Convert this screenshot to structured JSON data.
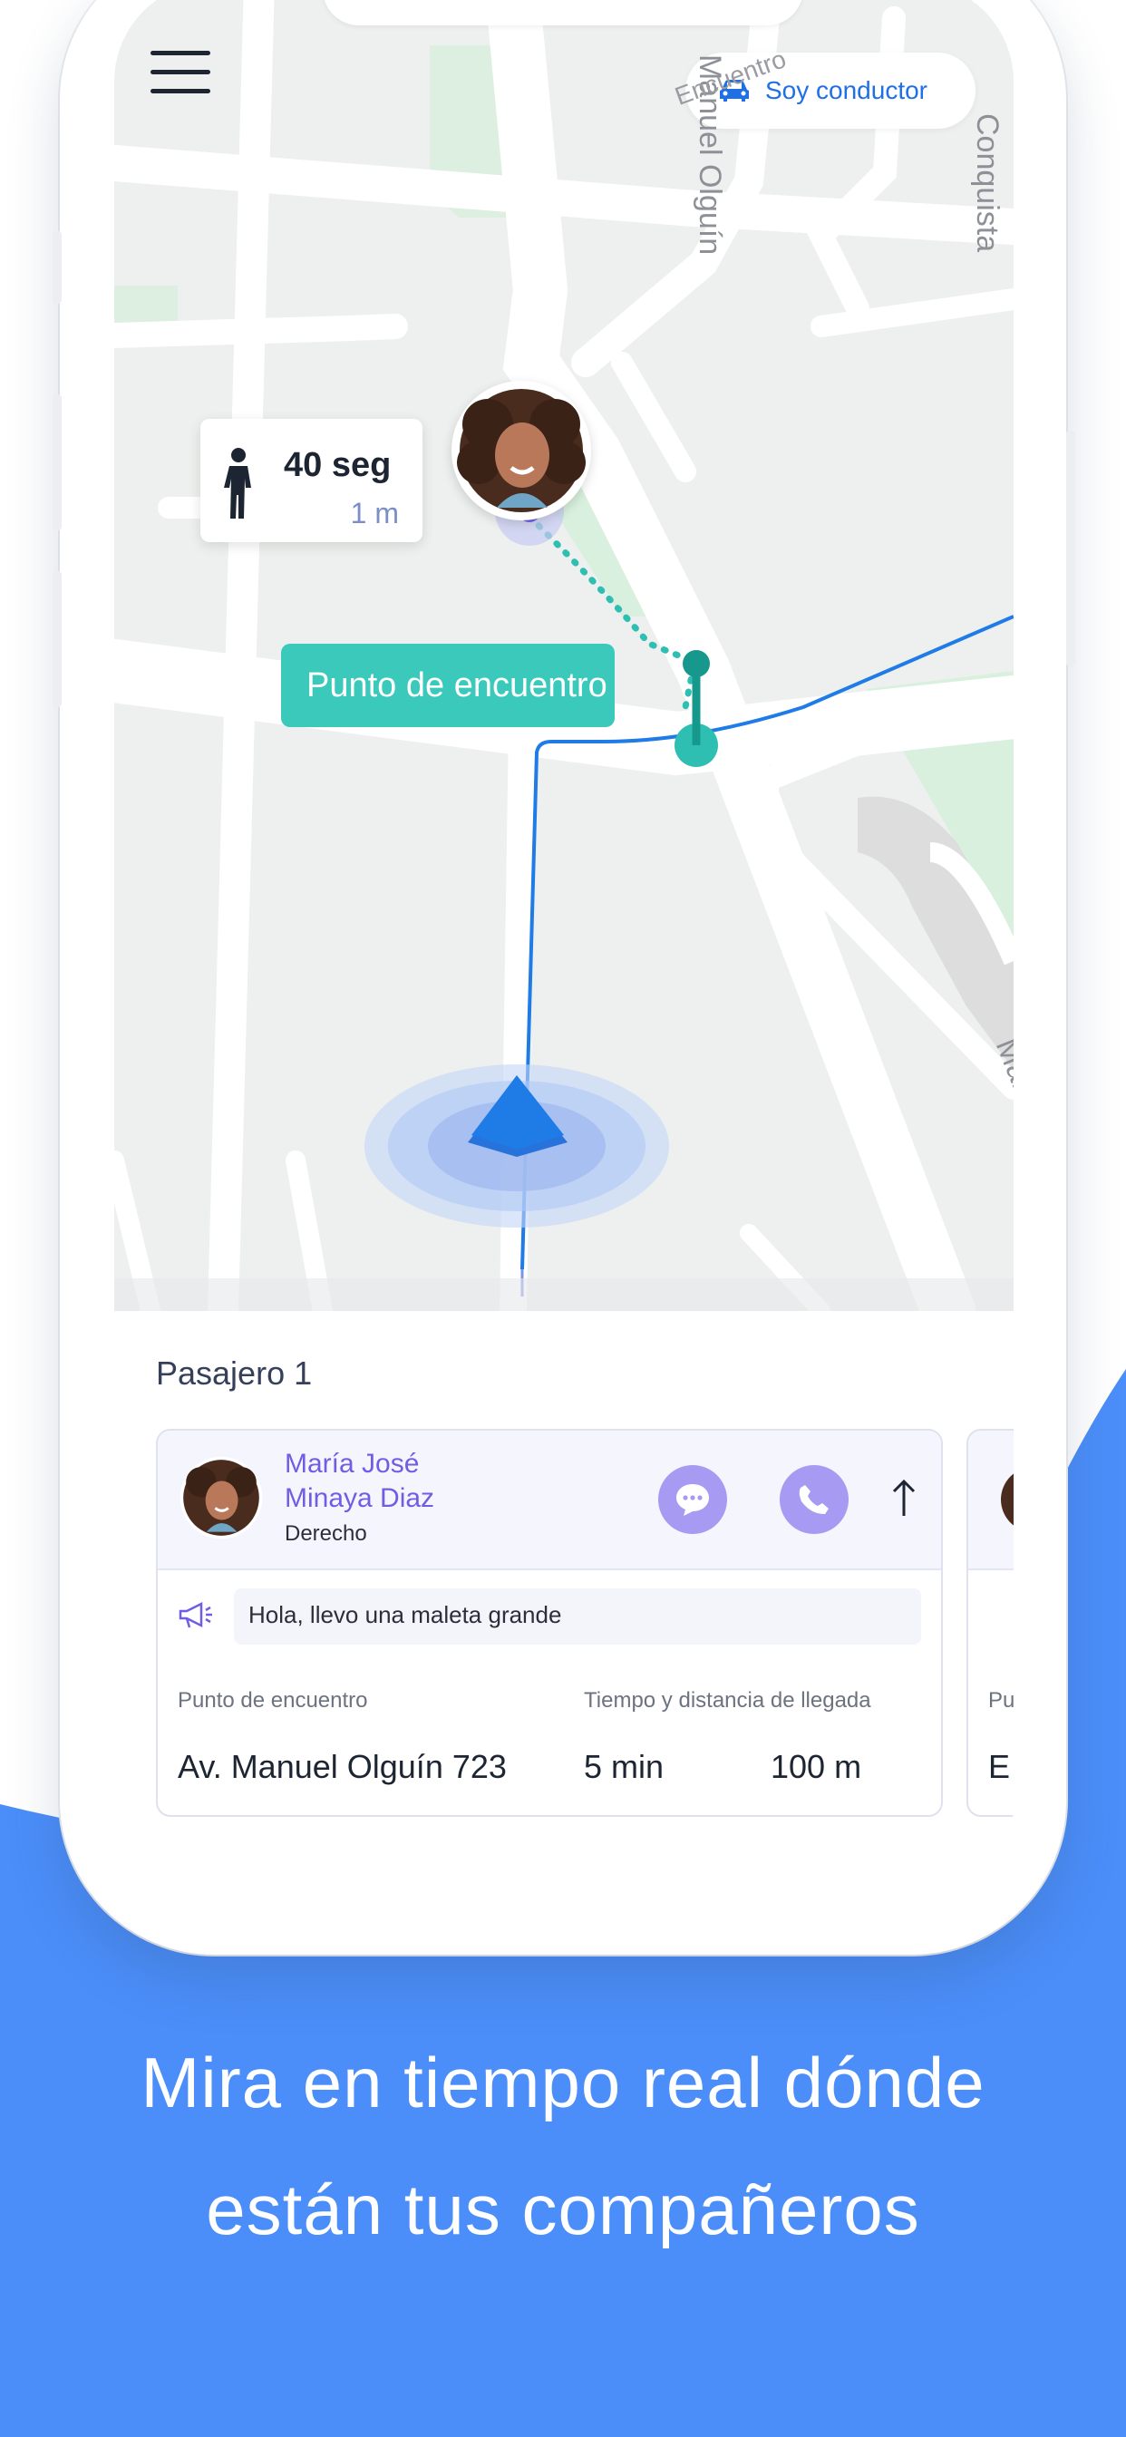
{
  "colors": {
    "background_blue": "#4b8ef9",
    "route_blue": "#1f7be6",
    "meeting_teal": "#3bc9bb",
    "accent_purple": "#a79af2",
    "name_purple": "#6f5ee2"
  },
  "map": {
    "driver_toggle_label": "Soy conductor",
    "driver_toggle_icon": "car-icon",
    "streets": {
      "manuel_olguin_top": "Manuel Olguín",
      "conquista": "Conquista",
      "encuentro_partial": "Encuentro",
      "manuel_olguin_bottom": "Manuel Olguín"
    },
    "walk_card": {
      "time": "40 seg",
      "distance": "1 m",
      "icon": "walking-person-icon"
    },
    "meeting_point_label": "Punto de encuentro"
  },
  "panel": {
    "title": "Pasajero 1",
    "passenger": {
      "name_line1": "María José",
      "name_line2": "Minaya Diaz",
      "side": "Derecho",
      "chat_icon": "chat-bubble-icon",
      "phone_icon": "phone-icon",
      "expand_icon": "arrow-up-icon",
      "message_icon": "megaphone-icon",
      "message": "Hola, llevo una maleta grande",
      "meeting_label": "Punto de encuentro",
      "meeting_value": "Av. Manuel Olguín 723",
      "arrival_label": "Tiempo y distancia de llegada",
      "arrival_time": "5 min",
      "arrival_distance": "100 m"
    },
    "next_card": {
      "label_partial": "Pu",
      "value_partial": "E"
    }
  },
  "caption": {
    "line1": "Mira en tiempo real dónde",
    "line2": "están tus compañeros"
  }
}
